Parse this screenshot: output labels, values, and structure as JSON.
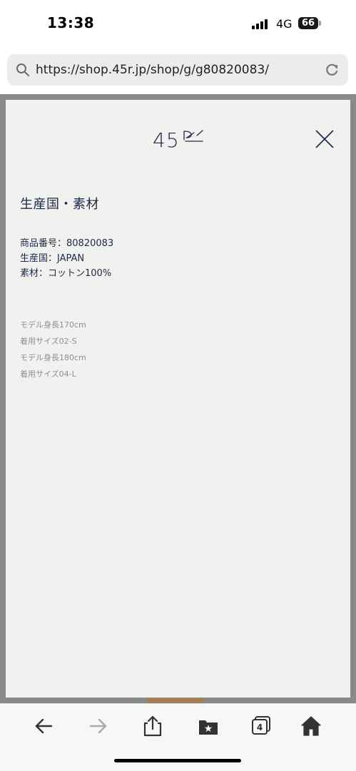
{
  "status": {
    "time": "13:38",
    "network": "4G",
    "battery": "66"
  },
  "browser": {
    "url": "https://shop.45r.jp/shop/g/g80820083/",
    "tab_count": "4"
  },
  "brand": {
    "logo_text": "45R"
  },
  "product_detail": {
    "section_title": "生産国・素材",
    "specs": [
      "商品番号：80820083",
      "生産国：JAPAN",
      "素材：コットン100%"
    ],
    "model_info": [
      "モデル身長170cm",
      "着用サイズ02-S",
      "モデル身長180cm",
      "着用サイズ04-L"
    ]
  },
  "toolbar": {
    "icons": [
      "back-arrow-icon",
      "forward-arrow-icon",
      "share-icon",
      "bookmarks-icon",
      "tabs-icon",
      "home-icon"
    ]
  },
  "colors": {
    "text_navy": "#1e2946",
    "panel_bg": "#f1f1ef",
    "overlay_frame": "#8a8a88",
    "muted_text": "#8c8f96"
  }
}
